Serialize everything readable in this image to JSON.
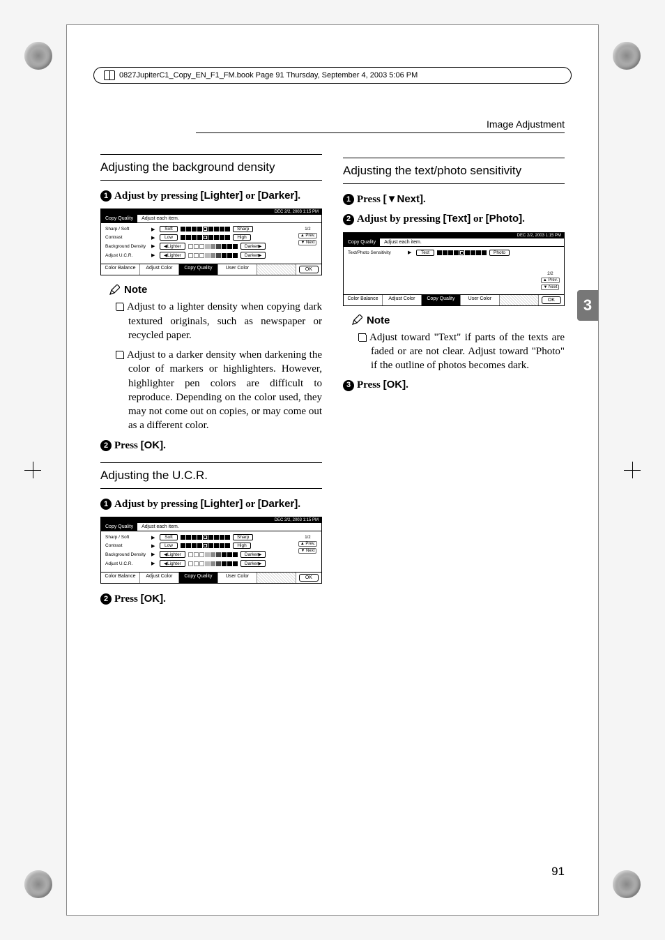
{
  "meta": {
    "filename": "0827JupiterC1_Copy_EN_F1_FM.book  Page 91  Thursday, September 4, 2003  5:06 PM"
  },
  "running_header": "Image Adjustment",
  "side_tab": "3",
  "page_number": "91",
  "left": {
    "section1_title": "Adjusting the background density",
    "step1_a": "Adjust by pressing ",
    "step1_b": "[Lighter]",
    "step1_c": " or ",
    "step1_d": "[Darker]",
    "step1_e": ".",
    "note_label": "Note",
    "note1": "Adjust to a lighter density when copying dark textured originals, such as newspaper or recycled paper.",
    "note2": "Adjust to a darker density when darkening the color of markers or highlighters. However, highlighter pen colors are difficult to reproduce. Depending on the color used, they may not come out on copies, or may come out as a different color.",
    "step2_a": "Press ",
    "step2_b": "[OK]",
    "step2_c": ".",
    "section2_title": "Adjusting the U.C.R.",
    "s2_step1_a": "Adjust by pressing ",
    "s2_step1_b": "[Lighter]",
    "s2_step1_c": " or ",
    "s2_step1_d": "[Darker]",
    "s2_step1_e": ".",
    "s2_step2_a": "Press ",
    "s2_step2_b": "[OK]",
    "s2_step2_c": "."
  },
  "right": {
    "section_title": "Adjusting the text/photo sensitivity",
    "step1_a": "Press ",
    "step1_b": "[▼Next]",
    "step1_c": ".",
    "step2_a": "Adjust by pressing ",
    "step2_b": "[Text]",
    "step2_c": " or ",
    "step2_d": "[Photo]",
    "step2_e": ".",
    "note_label": "Note",
    "note1": "Adjust toward \"Text\" if parts of the texts are faded or are not clear. Adjust toward \"Photo\" if the outline of photos becomes dark.",
    "step3_a": "Press ",
    "step3_b": "[OK]",
    "step3_c": "."
  },
  "ss": {
    "date": "DEC   2/2, 2003  1:15 PM",
    "tab": "Copy Quality",
    "header": "Adjust each item.",
    "rows": {
      "sharp_soft": "Sharp / Soft",
      "contrast": "Contrast",
      "bg_density": "Background Density",
      "ucr": "Adjust U.C.R.",
      "text_photo": "Text/Photo Sensitivity"
    },
    "btns": {
      "soft": "Soft",
      "sharp": "Sharp",
      "low": "Low",
      "high": "High",
      "lighter": "◀Lighter",
      "darker": "Darker▶",
      "text": "Text",
      "photo": "Photo",
      "prev": "▲ Prev.",
      "next": "▼ Next",
      "ok": "OK"
    },
    "page1": "1/2",
    "page2": "2/2",
    "tabs": {
      "color_balance": "Color Balance",
      "adjust_color": "Adjust Color",
      "copy_quality": "Copy Quality",
      "user_color": "User Color"
    }
  }
}
